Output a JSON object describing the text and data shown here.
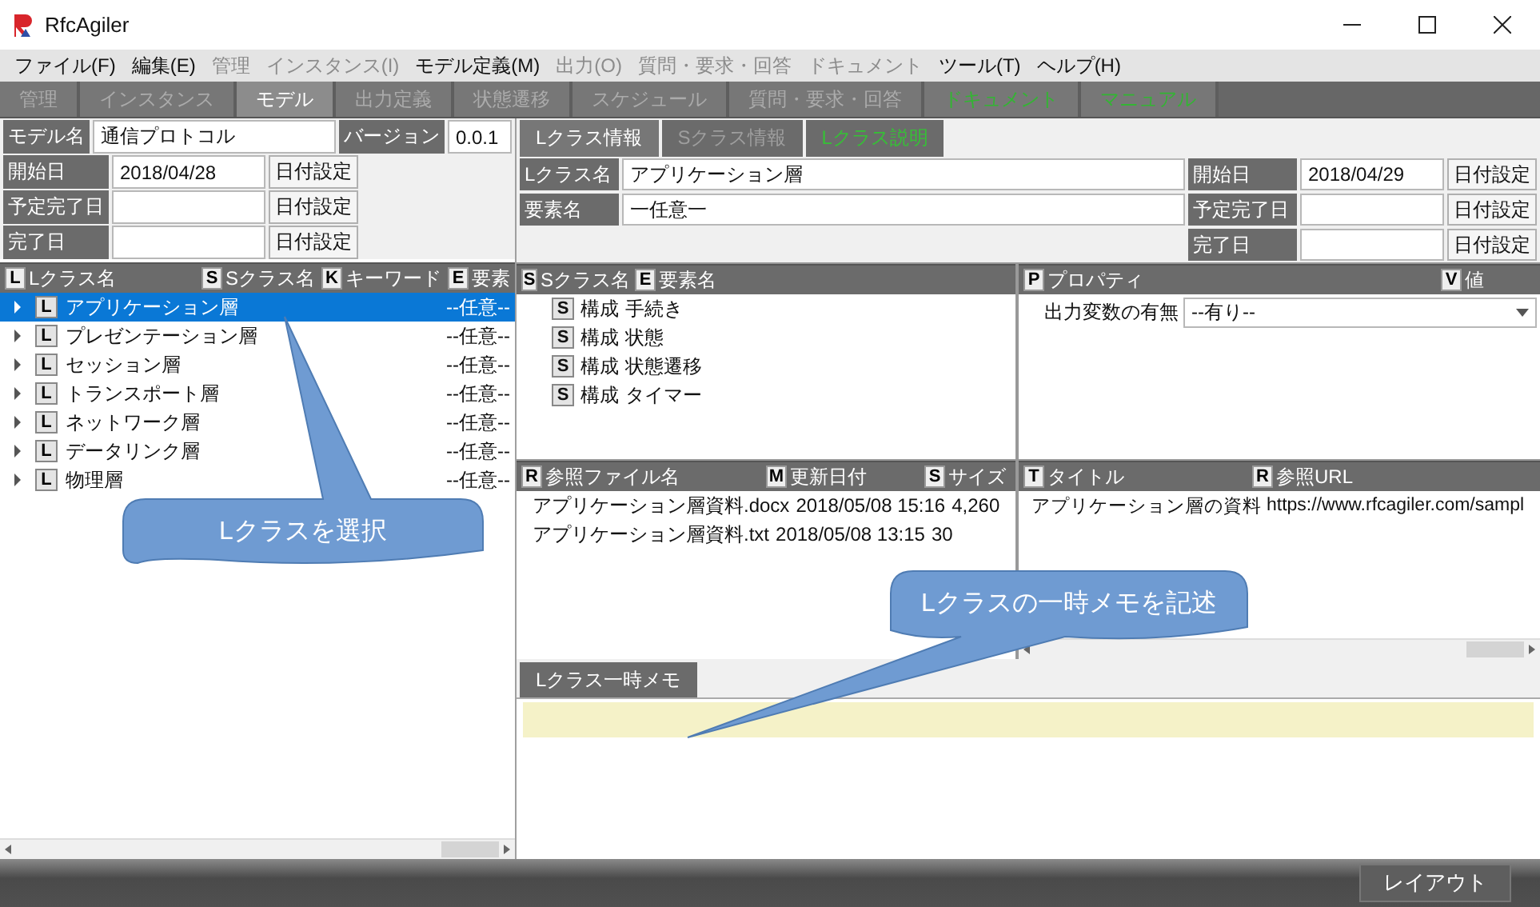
{
  "window": {
    "title": "RfcAgiler"
  },
  "menu": [
    {
      "label": "ファイル(F)",
      "disabled": false
    },
    {
      "label": "編集(E)",
      "disabled": false
    },
    {
      "label": "管理",
      "disabled": true
    },
    {
      "label": "インスタンス(I)",
      "disabled": true
    },
    {
      "label": "モデル定義(M)",
      "disabled": false
    },
    {
      "label": "出力(O)",
      "disabled": true
    },
    {
      "label": "質問・要求・回答",
      "disabled": true
    },
    {
      "label": "ドキュメント",
      "disabled": true
    },
    {
      "label": "ツール(T)",
      "disabled": false
    },
    {
      "label": "ヘルプ(H)",
      "disabled": false
    }
  ],
  "tabs": [
    {
      "label": "管理",
      "selected": false,
      "kind": "plain"
    },
    {
      "label": "インスタンス",
      "selected": false,
      "kind": "plain"
    },
    {
      "label": "モデル",
      "selected": true,
      "kind": "plain"
    },
    {
      "label": "出力定義",
      "selected": false,
      "kind": "plain"
    },
    {
      "label": "状態遷移",
      "selected": false,
      "kind": "plain"
    },
    {
      "label": "スケジュール",
      "selected": false,
      "kind": "plain"
    },
    {
      "label": "質問・要求・回答",
      "selected": false,
      "kind": "plain"
    },
    {
      "label": "ドキュメント",
      "selected": false,
      "kind": "link"
    },
    {
      "label": "マニュアル",
      "selected": false,
      "kind": "link"
    }
  ],
  "model": {
    "name_label": "モデル名",
    "name": "通信プロトコル",
    "version_label": "バージョン",
    "version": "0.0.1",
    "dates": [
      {
        "label": "開始日",
        "value": "2018/04/28",
        "button": "日付設定"
      },
      {
        "label": "予定完了日",
        "button": "日付設定"
      },
      {
        "label": "完了日",
        "button": "日付設定"
      }
    ]
  },
  "tree": {
    "columns": [
      {
        "icon": "L",
        "label": "Lクラス名"
      },
      {
        "icon": "S",
        "label": "Sクラス名"
      },
      {
        "icon": "K",
        "label": "キーワード"
      },
      {
        "icon": "E",
        "label": "要素"
      }
    ],
    "rows": [
      {
        "icon": "L",
        "name": "アプリケーション層",
        "element": "--任意--",
        "selected": true,
        "expanded": false
      },
      {
        "icon": "L",
        "name": "プレゼンテーション層",
        "element": "--任意--",
        "selected": false,
        "expanded": false
      },
      {
        "icon": "L",
        "name": "セッション層",
        "element": "--任意--",
        "selected": false,
        "expanded": false
      },
      {
        "icon": "L",
        "name": "トランスポート層",
        "element": "--任意--",
        "selected": false,
        "expanded": false
      },
      {
        "icon": "L",
        "name": "ネットワーク層",
        "element": "--任意--",
        "selected": false,
        "expanded": false
      },
      {
        "icon": "L",
        "name": "データリンク層",
        "element": "--任意--",
        "selected": false,
        "expanded": false
      },
      {
        "icon": "L",
        "name": "物理層",
        "element": "--任意--",
        "selected": false,
        "expanded": false
      }
    ]
  },
  "detail": {
    "tabs": [
      {
        "label": "Lクラス情報",
        "selected": true,
        "kind": "plain"
      },
      {
        "label": "Sクラス情報",
        "selected": false,
        "kind": "plain"
      },
      {
        "label": "Lクラス説明",
        "selected": false,
        "kind": "link"
      }
    ],
    "fields": [
      {
        "label": "Lクラス名",
        "value": "アプリケーション層"
      },
      {
        "label": "要素名",
        "value": "一任意一"
      }
    ],
    "dates": [
      {
        "label": "開始日",
        "value": "2018/04/29",
        "button": "日付設定"
      },
      {
        "label": "予定完了日",
        "button": "日付設定"
      },
      {
        "label": "完了日",
        "button": "日付設定"
      }
    ]
  },
  "sclasses": {
    "columns": [
      {
        "icon": "S",
        "label": "Sクラス名"
      },
      {
        "icon": "E",
        "label": "要素名"
      }
    ],
    "rows": [
      {
        "icon": "S",
        "name": "構成",
        "element": "手続き"
      },
      {
        "icon": "S",
        "name": "構成",
        "element": "状態"
      },
      {
        "icon": "S",
        "name": "構成",
        "element": "状態遷移"
      },
      {
        "icon": "S",
        "name": "構成",
        "element": "タイマー"
      }
    ]
  },
  "properties": {
    "columns": [
      {
        "icon": "P",
        "label": "プロパティ"
      },
      {
        "icon": "V",
        "label": "値"
      }
    ],
    "rows": [
      {
        "name": "出力変数の有無",
        "value": "--有り--"
      }
    ]
  },
  "files": {
    "columns": [
      {
        "icon": "R",
        "label": "参照ファイル名"
      },
      {
        "icon": "M",
        "label": "更新日付"
      },
      {
        "icon": "S",
        "label": "サイズ"
      }
    ],
    "rows": [
      {
        "name": "アプリケーション層資料.docx",
        "date": "2018/05/08 15:16",
        "size": "4,260"
      },
      {
        "name": "アプリケーション層資料.txt",
        "date": "2018/05/08 13:15",
        "size": "30"
      }
    ]
  },
  "links": {
    "columns": [
      {
        "icon": "T",
        "label": "タイトル"
      },
      {
        "icon": "R",
        "label": "参照URL"
      }
    ],
    "rows": [
      {
        "title": "アプリケーション層の資料",
        "url": "https://www.rfcagiler.com/sampl"
      }
    ]
  },
  "memo": {
    "tab": "Lクラス一時メモ"
  },
  "callouts": [
    {
      "text": "Lクラスを選択"
    },
    {
      "text": "Lクラスの一時メモを記述"
    }
  ],
  "status_bar": {
    "button": "レイアウト"
  }
}
